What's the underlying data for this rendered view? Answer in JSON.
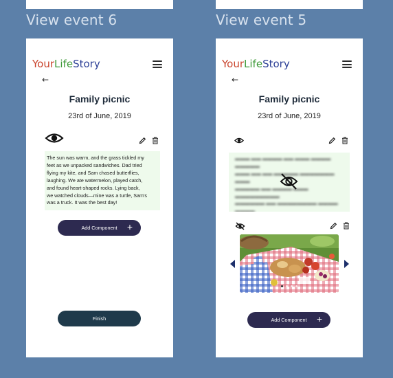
{
  "brand": {
    "part1": "Your",
    "part2": "Life",
    "part3": "Story"
  },
  "frames": [
    {
      "title": "View event 6",
      "event": {
        "title": "Family picnic",
        "date": "23rd of June, 2019",
        "story_lines": [
          "The sun was warm, and the grass tickled my",
          "feet as we unpacked sandwiches. Dad tried",
          "flying my kite, and Sam chased butterflies,",
          "laughing. We ate watermelon, played catch,",
          "and found heart-shaped rocks. Lying back,",
          "we watched clouds—mine was a turtle, Sam's",
          "was a truck. It was the best day!"
        ]
      },
      "add_component_label": "Add Component",
      "finish_label": "Finish"
    },
    {
      "title": "View event 5",
      "event": {
        "title": "Family picnic",
        "date": "23rd of June, 2019"
      },
      "add_component_label": "Add Component",
      "carousel": {
        "slide_count": 4,
        "active_index": 0
      }
    }
  ],
  "icons": {
    "menu": "hamburger-menu-icon",
    "back": "back-arrow-icon",
    "visible": "eye-icon",
    "hidden": "eye-off-icon",
    "edit": "pencil-icon",
    "delete": "trash-icon",
    "add": "plus-icon",
    "prev": "carousel-prev-icon",
    "next": "carousel-next-icon"
  },
  "colors": {
    "background": "#5c80a9",
    "text_box_bg": "#eefaec",
    "primary_button": "#2d2a50",
    "finish_button": "#1f3a4b",
    "logo_your": "#c9442c",
    "logo_life": "#3f9a3a",
    "logo_story": "#2c3f96"
  }
}
